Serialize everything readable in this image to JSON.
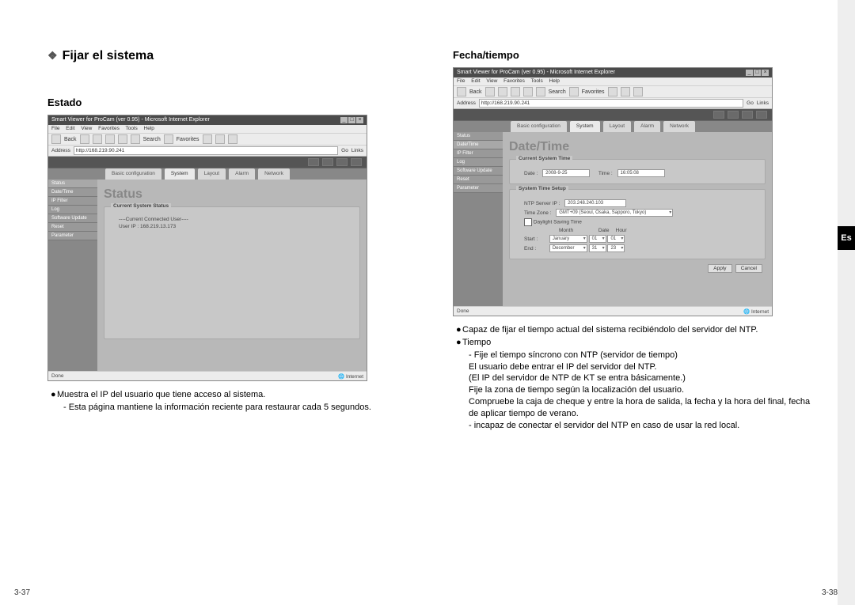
{
  "side_tab": "Es",
  "page_left": "3-37",
  "page_right": "3-38",
  "left": {
    "main_title": "Fijar el sistema",
    "subtitle": "Estado",
    "screenshot": {
      "window_title": "Smart Viewer for ProCam (ver 0.95) - Microsoft Internet Explorer",
      "menus": [
        "File",
        "Edit",
        "View",
        "Favorites",
        "Tools",
        "Help"
      ],
      "toolbar": {
        "back": "Back",
        "search": "Search",
        "favorites": "Favorites"
      },
      "address_label": "Address",
      "address": "http://168.219.90.241",
      "go_label": "Go",
      "links_label": "Links",
      "tabs": [
        "Basic configuration",
        "System",
        "Layout",
        "Alarm",
        "Network"
      ],
      "active_tab": 1,
      "sidebar": [
        "Status",
        "Date/Time",
        "IP Filter",
        "Log",
        "Software Update",
        "Reset",
        "Parameter"
      ],
      "main_title": "Status",
      "group_title": "Current System Status",
      "conn_user_label": "----Current Connected User----",
      "user_ip": "User IP : 168.219.13.173",
      "status_left": "Done",
      "status_right": "Internet"
    },
    "bullets": [
      "Muestra el IP del usuario que tiene acceso al sistema.",
      "- Esta página mantiene la información reciente para restaurar cada 5 segundos."
    ]
  },
  "right": {
    "subtitle": "Fecha/tiempo",
    "screenshot": {
      "window_title": "Smart Viewer for ProCam (ver 0.95) - Microsoft Internet Explorer",
      "menus": [
        "File",
        "Edit",
        "View",
        "Favorites",
        "Tools",
        "Help"
      ],
      "toolbar": {
        "back": "Back",
        "search": "Search",
        "favorites": "Favorites"
      },
      "address_label": "Address",
      "address": "http://168.219.90.241",
      "go_label": "Go",
      "links_label": "Links",
      "tabs": [
        "Basic configuration",
        "System",
        "Layout",
        "Alarm",
        "Network"
      ],
      "active_tab": 1,
      "sidebar": [
        "Status",
        "Date/Time",
        "IP Filter",
        "Log",
        "Software Update",
        "Reset",
        "Parameter"
      ],
      "main_title": "Date/Time",
      "group1_title": "Current System Time",
      "date_label": "Date :",
      "date_value": "2008-9-25",
      "time_label": "Time :",
      "time_value": "16:05:08",
      "group2_title": "System Time Setup",
      "ntp_label": "NTP Server IP :",
      "ntp_value": "203.248.240.103",
      "tz_label": "Time Zone :",
      "tz_value": "GMT+09 (Seoul, Osaka, Sapporo, Tokyo)",
      "dst_label": "Daylight Saving Time",
      "col_month": "Month",
      "col_date": "Date",
      "col_hour": "Hour",
      "start_label": "Start :",
      "start_month": "January",
      "start_date": "01",
      "start_hour": "01",
      "end_label": "End :",
      "end_month": "December",
      "end_date": "31",
      "end_hour": "23",
      "apply": "Apply",
      "cancel": "Cancel",
      "status_left": "Done",
      "status_right": "Internet"
    },
    "bullets": [
      "Capaz de fijar el tiempo actual del sistema recibiéndolo del servidor del NTP.",
      "Tiempo",
      "- Fije el tiempo síncrono con NTP (servidor de tiempo)",
      "El usuario debe entrar el IP del servidor del NTP.",
      "(El IP del servidor de NTP de KT se entra básicamente.)",
      "Fije la zona de tiempo según la localización del usuario.",
      "Compruebe la caja de cheque y entre la hora de salida, la fecha y la hora del final, fecha de aplicar tiempo de verano.",
      "- incapaz de conectar el servidor del NTP en caso de usar la red local."
    ]
  }
}
